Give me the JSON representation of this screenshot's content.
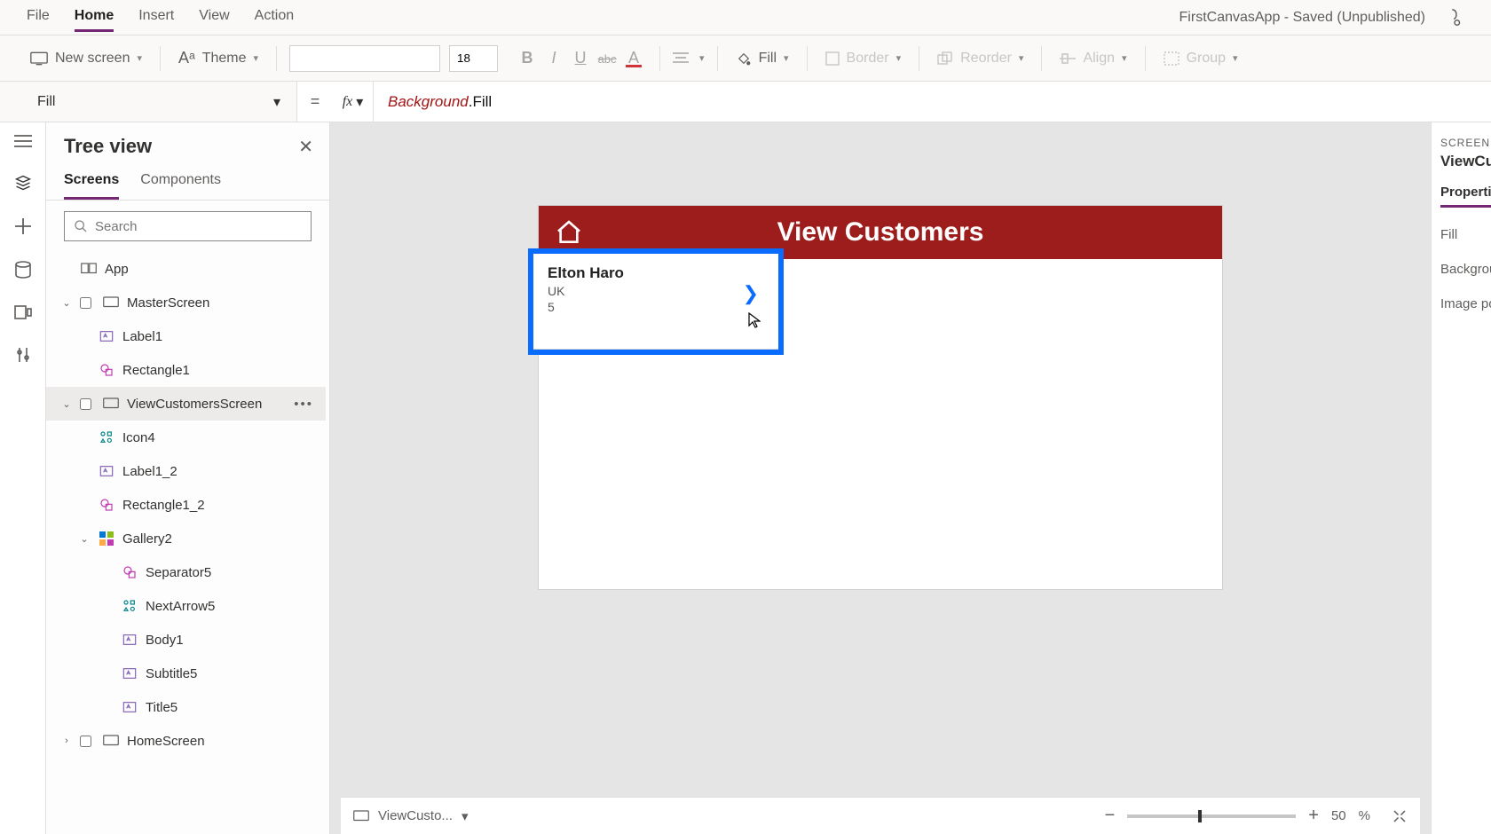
{
  "menu": {
    "items": [
      "File",
      "Home",
      "Insert",
      "View",
      "Action"
    ],
    "active_index": 1,
    "app_title": "FirstCanvasApp - Saved (Unpublished)"
  },
  "ribbon": {
    "new_screen": "New screen",
    "theme": "Theme",
    "font_name": "",
    "font_size": "18",
    "fill": "Fill",
    "border": "Border",
    "reorder": "Reorder",
    "align": "Align",
    "group": "Group"
  },
  "formula_bar": {
    "property": "Fill",
    "expression_obj": "Background",
    "expression_prop": ".Fill"
  },
  "tree": {
    "title": "Tree view",
    "tabs": [
      "Screens",
      "Components"
    ],
    "active_tab": 0,
    "search_placeholder": "Search",
    "nodes": [
      {
        "label": "App",
        "icon": "app",
        "indent": 0,
        "expander": ""
      },
      {
        "label": "MasterScreen",
        "icon": "screen",
        "indent": 0,
        "expander": "▽"
      },
      {
        "label": "Label1",
        "icon": "label",
        "indent": 1,
        "expander": ""
      },
      {
        "label": "Rectangle1",
        "icon": "shape",
        "indent": 1,
        "expander": ""
      },
      {
        "label": "ViewCustomersScreen",
        "icon": "screen",
        "indent": 0,
        "expander": "▽",
        "selected": true,
        "more": true
      },
      {
        "label": "Icon4",
        "icon": "iconctl",
        "indent": 1,
        "expander": ""
      },
      {
        "label": "Label1_2",
        "icon": "label",
        "indent": 1,
        "expander": ""
      },
      {
        "label": "Rectangle1_2",
        "icon": "shape",
        "indent": 1,
        "expander": ""
      },
      {
        "label": "Gallery2",
        "icon": "gallery",
        "indent": 1,
        "expander": "▽"
      },
      {
        "label": "Separator5",
        "icon": "shape",
        "indent": 2,
        "expander": ""
      },
      {
        "label": "NextArrow5",
        "icon": "iconctl",
        "indent": 2,
        "expander": ""
      },
      {
        "label": "Body1",
        "icon": "label",
        "indent": 2,
        "expander": ""
      },
      {
        "label": "Subtitle5",
        "icon": "label",
        "indent": 2,
        "expander": ""
      },
      {
        "label": "Title5",
        "icon": "label",
        "indent": 2,
        "expander": ""
      },
      {
        "label": "HomeScreen",
        "icon": "screen",
        "indent": 0,
        "expander": "▷"
      }
    ]
  },
  "canvas": {
    "header_title": "View Customers",
    "gallery_item": {
      "title": "Elton  Haro",
      "subtitle": "UK",
      "body": "5"
    }
  },
  "statusbar": {
    "screen_label": "ViewCusto...",
    "zoom_value": "50",
    "zoom_suffix": "%"
  },
  "props": {
    "section_label": "SCREEN",
    "screen_name": "ViewCusto",
    "tab": "Properties",
    "rows": [
      "Fill",
      "Background",
      "Image posit"
    ]
  }
}
